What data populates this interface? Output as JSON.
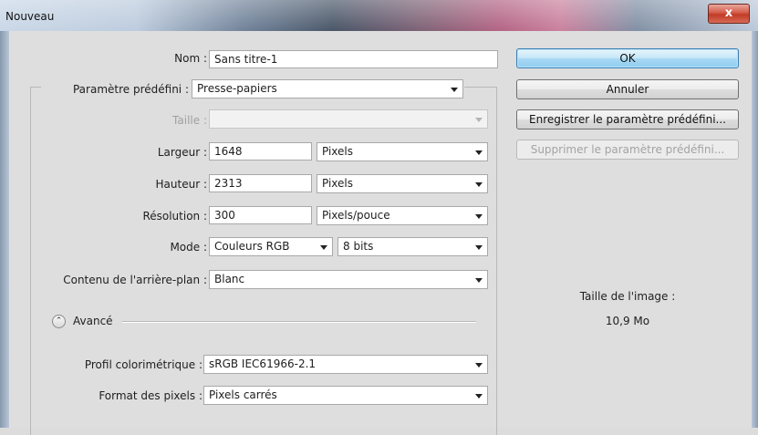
{
  "window": {
    "title": "Nouveau",
    "close_label": "x"
  },
  "fields": {
    "nom": {
      "label": "Nom :",
      "value": "Sans titre-1"
    },
    "preset": {
      "label": "Paramètre prédéfini :",
      "value": "Presse-papiers"
    },
    "taille": {
      "label": "Taille :",
      "value": ""
    },
    "largeur": {
      "label": "Largeur :",
      "value": "1648",
      "unit": "Pixels"
    },
    "hauteur": {
      "label": "Hauteur :",
      "value": "2313",
      "unit": "Pixels"
    },
    "resolution": {
      "label": "Résolution :",
      "value": "300",
      "unit": "Pixels/pouce"
    },
    "mode": {
      "label": "Mode :",
      "value": "Couleurs RGB",
      "depth": "8 bits"
    },
    "contenu": {
      "label": "Contenu de l'arrière-plan :",
      "value": "Blanc"
    }
  },
  "advanced": {
    "toggle_label": "Avancé",
    "toggle_icon": "chevron-up-icon",
    "profil": {
      "label": "Profil colorimétrique :",
      "value": "sRGB IEC61966-2.1"
    },
    "format": {
      "label": "Format des pixels :",
      "value": "Pixels carrés"
    }
  },
  "buttons": {
    "ok": "OK",
    "annuler": "Annuler",
    "enregistrer": "Enregistrer le paramètre prédéfini...",
    "supprimer": "Supprimer le paramètre prédéfini..."
  },
  "image_size": {
    "label": "Taille de l'image :",
    "value": "10,9 Mo"
  }
}
